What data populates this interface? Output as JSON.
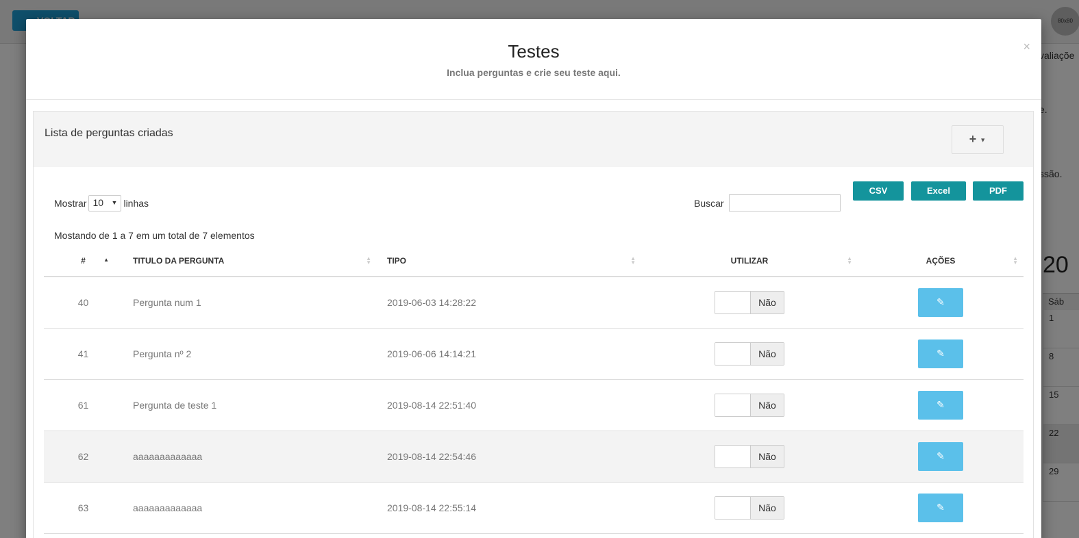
{
  "background": {
    "back_button": "VOLTAR",
    "avatar_text": "80x80",
    "right_texts": [
      "valiaçõe",
      "e.",
      "ssão."
    ],
    "year": "20",
    "calendar_header": "Sáb",
    "calendar_days": [
      "1",
      "8",
      "15",
      "22",
      "29"
    ]
  },
  "modal": {
    "title": "Testes",
    "subtitle": "Inclua perguntas e crie seu teste aqui.",
    "close_icon": "×",
    "panel_title": "Lista de perguntas criadas",
    "add_button": "+"
  },
  "toolbar": {
    "export_buttons": [
      "CSV",
      "Excel",
      "PDF"
    ],
    "show_label": "Mostrar",
    "page_size": "10",
    "rows_label": "linhas",
    "search_label": "Buscar",
    "search_value": ""
  },
  "info": "Mostando de 1 a 7 em um total de 7 elementos",
  "table": {
    "columns": [
      "#",
      "TITULO DA PERGUNTA",
      "TIPO",
      "UTILIZAR",
      "AÇÕES"
    ],
    "rows": [
      {
        "id": "40",
        "title": "Pergunta num 1",
        "tipo": "2019-06-03 14:28:22",
        "utilizar": "Não"
      },
      {
        "id": "41",
        "title": "Pergunta nº 2",
        "tipo": "2019-06-06 14:14:21",
        "utilizar": "Não"
      },
      {
        "id": "61",
        "title": "Pergunta de teste 1",
        "tipo": "2019-08-14 22:51:40",
        "utilizar": "Não"
      },
      {
        "id": "62",
        "title": "aaaaaaaaaaaaa",
        "tipo": "2019-08-14 22:54:46",
        "utilizar": "Não"
      },
      {
        "id": "63",
        "title": "aaaaaaaaaaaaa",
        "tipo": "2019-08-14 22:55:14",
        "utilizar": "Não"
      }
    ]
  },
  "colors": {
    "export_button": "#14949c",
    "edit_button": "#5bc0ea"
  }
}
